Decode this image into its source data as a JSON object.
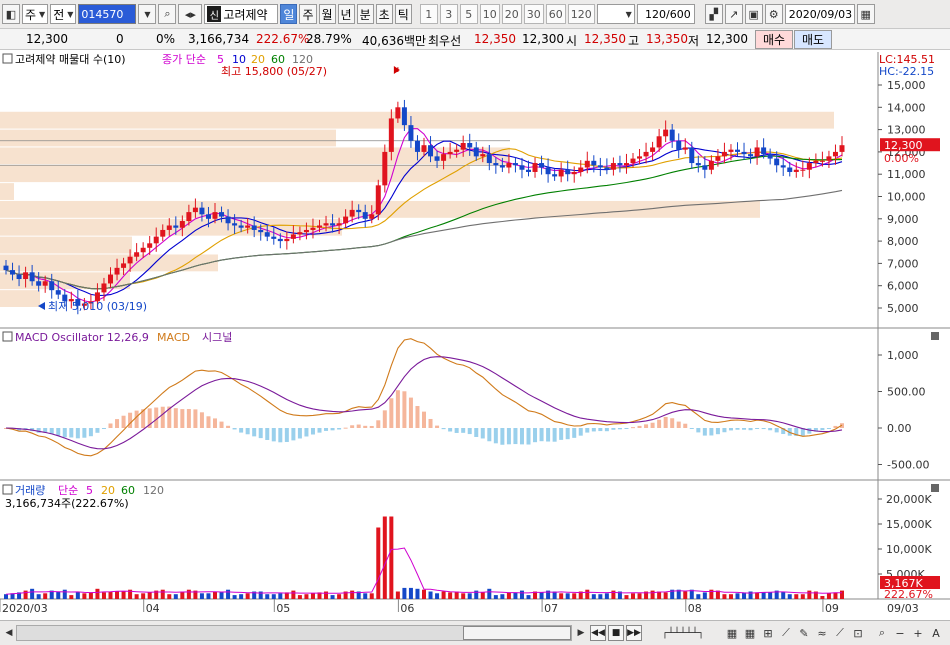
{
  "toolbar": {
    "market": "주",
    "market_type": "전",
    "stock_code": "014570",
    "stock_badge": "신",
    "stock_name": "고려제약",
    "periods": [
      "일",
      "주",
      "월",
      "년",
      "분",
      "초",
      "틱"
    ],
    "active_period": "일",
    "intervals": [
      "1",
      "3",
      "5",
      "10",
      "20",
      "30",
      "60",
      "120"
    ],
    "count": "120/600",
    "date": "2020/09/03"
  },
  "quote": {
    "price": "12,300",
    "change": "0",
    "change_pct": "0%",
    "volume": "3,166,734",
    "volume_ratio": "222.67%",
    "turnover": "28.79%",
    "amount": "40,636백만",
    "best_ask_label": "최우선",
    "best_ask": "12,350",
    "best_bid": "12,300",
    "open_label": "시",
    "open": "12,350",
    "high_label": "고",
    "high": "13,350",
    "low_label": "저",
    "low": "12,300",
    "buy_label": "매수",
    "sell_label": "매도"
  },
  "price_panel": {
    "legend_title": "고려제약 매물대 수(10)",
    "ma_label": "종가 단순",
    "ma_periods": [
      "5",
      "10",
      "20",
      "60",
      "120"
    ],
    "ma_colors": [
      "#d000d0",
      "#0000d0",
      "#e0a000",
      "#008000",
      "#707070"
    ],
    "lc": "LC:145.51",
    "hc": "HC:-22.15",
    "max_annotation": "최고 15,800 (05/27)",
    "min_annotation": "최저 5,010 (03/19)",
    "last_price_tag": "12,300",
    "pct_tag": "0.00%",
    "y_ticks": [
      "15,000",
      "14,000",
      "13,000",
      "12,000",
      "11,000",
      "10,000",
      "9,000",
      "8,000",
      "7,000",
      "6,000",
      "5,000"
    ]
  },
  "macd_panel": {
    "legend_osc": "MACD Oscillator 12,26,9",
    "legend_macd": "MACD",
    "legend_signal": "시그널",
    "y_ticks": [
      "1,000",
      "500.00",
      "0.00",
      "-500.00"
    ]
  },
  "volume_panel": {
    "legend_label": "거래량",
    "ma_label": "단순",
    "ma_periods": [
      "5",
      "20",
      "60",
      "120"
    ],
    "value_text": "3,166,734주(222.67%)",
    "y_ticks": [
      "20,000K",
      "15,000K",
      "10,000K",
      "5,000K"
    ],
    "last_tag": "3,167K",
    "pct_tag": "222.67%"
  },
  "x_axis": {
    "labels": [
      "2020/03",
      "04",
      "05",
      "06",
      "07",
      "08",
      "09",
      "09/03"
    ]
  },
  "colors": {
    "up": "#e0141e",
    "down": "#1448c8",
    "volume_profile": "#f7e2cf",
    "osc_positive": "#f5b69b",
    "osc_negative": "#9ad0ec",
    "macd": "#d07a1a",
    "signal": "#7a1a9a"
  },
  "chart_data": {
    "type": "candlestick",
    "x": [
      "03/02",
      "03/03",
      "03/04",
      "03/05",
      "03/06",
      "03/09",
      "03/10",
      "03/11",
      "03/12",
      "03/13",
      "03/16",
      "03/17",
      "03/18",
      "03/19",
      "03/20",
      "03/23",
      "03/24",
      "03/25",
      "03/26",
      "03/27",
      "03/30",
      "03/31",
      "04/01",
      "04/02",
      "04/03",
      "04/06",
      "04/07",
      "04/08",
      "04/09",
      "04/10",
      "04/13",
      "04/14",
      "04/16",
      "04/17",
      "04/20",
      "04/21",
      "04/22",
      "04/23",
      "04/24",
      "04/27",
      "04/28",
      "04/29",
      "05/04",
      "05/06",
      "05/07",
      "05/08",
      "05/11",
      "05/12",
      "05/13",
      "05/14",
      "05/15",
      "05/18",
      "05/19",
      "05/20",
      "05/21",
      "05/22",
      "05/25",
      "05/26",
      "05/27",
      "05/28",
      "05/29",
      "06/01",
      "06/02",
      "06/03",
      "06/04",
      "06/05",
      "06/08",
      "06/09",
      "06/10",
      "06/11",
      "06/12",
      "06/15",
      "06/16",
      "06/17",
      "06/18",
      "06/19",
      "06/22",
      "06/23",
      "06/24",
      "06/25",
      "06/26",
      "06/29",
      "06/30",
      "07/01",
      "07/02",
      "07/03",
      "07/06",
      "07/07",
      "07/08",
      "07/09",
      "07/10",
      "07/13",
      "07/14",
      "07/15",
      "07/16",
      "07/17",
      "07/20",
      "07/21",
      "07/22",
      "07/23",
      "07/24",
      "07/27",
      "07/28",
      "07/29",
      "07/30",
      "07/31",
      "08/03",
      "08/04",
      "08/05",
      "08/06",
      "08/07",
      "08/10",
      "08/11",
      "08/12",
      "08/13",
      "08/14",
      "08/18",
      "08/19",
      "08/20",
      "08/21",
      "08/24",
      "08/25",
      "08/26",
      "08/27",
      "08/28",
      "08/31",
      "09/01",
      "09/02",
      "09/03"
    ],
    "close": [
      6700,
      6500,
      6300,
      6600,
      6200,
      6000,
      6200,
      5800,
      5600,
      5300,
      5400,
      5100,
      5200,
      5300,
      5700,
      6100,
      6500,
      6800,
      7000,
      7300,
      7500,
      7700,
      7900,
      8200,
      8500,
      8700,
      8600,
      8900,
      9300,
      9500,
      9200,
      9000,
      9300,
      9100,
      8800,
      8700,
      8600,
      8700,
      8500,
      8400,
      8200,
      8100,
      8000,
      8100,
      8300,
      8400,
      8500,
      8600,
      8700,
      8800,
      8700,
      8800,
      9100,
      9400,
      9300,
      9000,
      9200,
      10500,
      12000,
      13500,
      14000,
      13200,
      12500,
      12000,
      12300,
      11800,
      11600,
      11900,
      12000,
      12100,
      12400,
      12200,
      11800,
      11900,
      11500,
      11400,
      11300,
      11500,
      11400,
      11200,
      11100,
      11500,
      11300,
      11000,
      10900,
      11200,
      11000,
      11100,
      11300,
      11600,
      11400,
      11300,
      11200,
      11500,
      11400,
      11500,
      11700,
      11800,
      12000,
      12200,
      12700,
      13000,
      12500,
      12100,
      12200,
      11500,
      11400,
      11200,
      11600,
      11800,
      12000,
      12100,
      12000,
      11900,
      11800,
      12200,
      11900,
      11700,
      11400,
      11300,
      11100,
      11200,
      11200,
      11500,
      11600,
      11600,
      11800,
      12000,
      12300
    ],
    "ylabel": "",
    "ylim": [
      4500,
      16000
    ]
  }
}
